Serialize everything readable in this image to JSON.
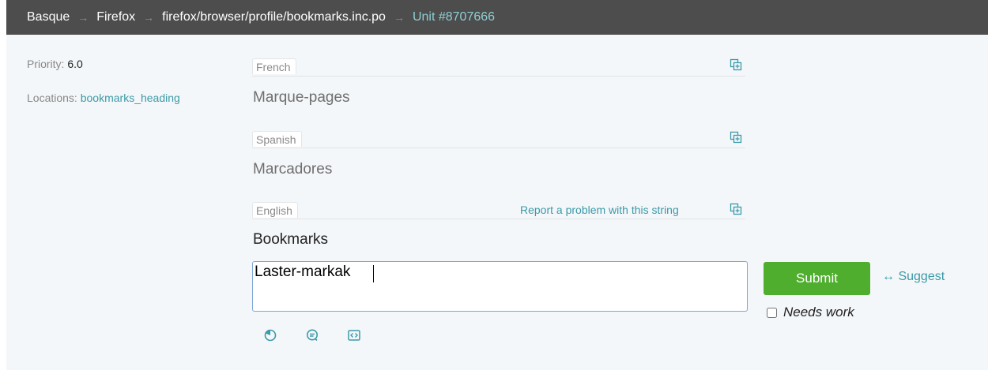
{
  "breadcrumb": {
    "language": "Basque",
    "project": "Firefox",
    "file": "firefox/browser/profile/bookmarks.inc.po",
    "unit": "Unit #8707666",
    "separator": "→"
  },
  "meta": {
    "priority_label": "Priority:",
    "priority_value": "6.0",
    "locations_label": "Locations:",
    "locations_value": "bookmarks_heading"
  },
  "alternatives": [
    {
      "language": "French",
      "text": "Marque-pages"
    },
    {
      "language": "Spanish",
      "text": "Marcadores"
    }
  ],
  "source": {
    "language": "English",
    "text": "Bookmarks",
    "report_link": "Report a problem with this string"
  },
  "editor": {
    "value": "Laster-markak"
  },
  "actions": {
    "submit_label": "Submit",
    "suggest_label": "↔ Suggest",
    "needs_work_label": "Needs work",
    "needs_work_checked": false
  },
  "icons": {
    "copy": "copy-icon",
    "tools": [
      "history-icon",
      "comment-icon",
      "code-icon"
    ]
  },
  "colors": {
    "accent": "#3b9aa8",
    "submit": "#4fae2e",
    "topbar": "#4d4d4d"
  }
}
